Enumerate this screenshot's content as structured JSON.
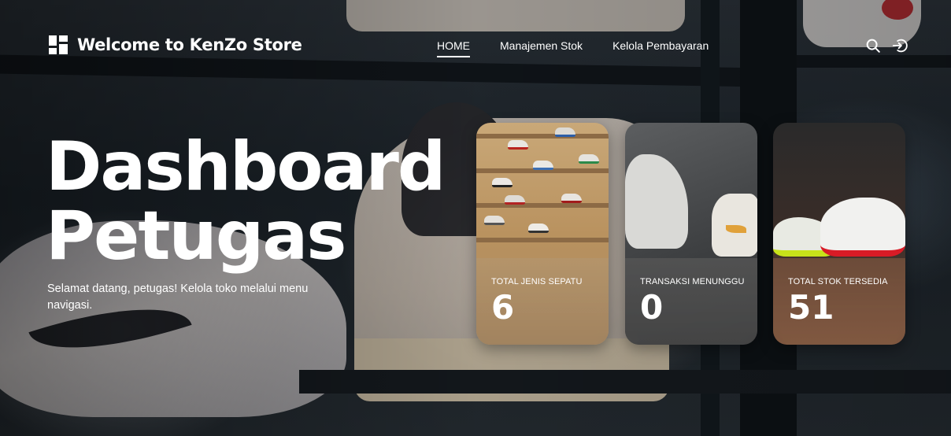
{
  "header": {
    "brand_title": "Welcome to KenZo Store",
    "nav": [
      {
        "label": "HOME",
        "active": true
      },
      {
        "label": "Manajemen Stok",
        "active": false
      },
      {
        "label": "Kelola Pembayaran",
        "active": false
      }
    ],
    "icons": [
      "search-icon",
      "logout-icon"
    ]
  },
  "hero": {
    "title_line1": "Dashboard",
    "title_line2": "Petugas",
    "subtitle": "Selamat datang, petugas! Kelola toko melalui menu navigasi."
  },
  "cards": [
    {
      "label": "TOTAL JENIS SEPATU",
      "value": "6"
    },
    {
      "label": "TRANSAKSI MENUNGGU",
      "value": "0"
    },
    {
      "label": "TOTAL STOK TERSEDIA",
      "value": "51"
    }
  ],
  "colors": {
    "text": "#ffffff",
    "background": "#1b2228"
  }
}
